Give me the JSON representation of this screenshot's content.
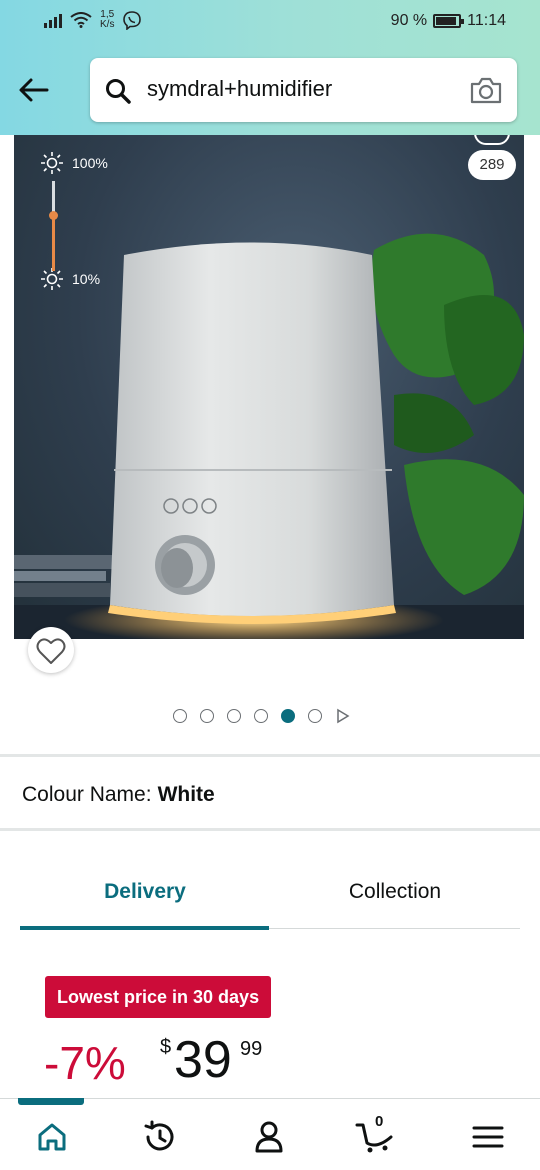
{
  "status_bar": {
    "net_speed_value": "1,5",
    "net_speed_unit": "K/s",
    "battery_percent": "90 %",
    "battery_level": 0.9,
    "time": "11:14"
  },
  "search": {
    "query": "symdral+humidifier"
  },
  "product": {
    "image_count_badge": "289",
    "brightness_max": "100%",
    "brightness_min": "10%",
    "carousel": {
      "total": 6,
      "active_index": 4
    }
  },
  "variation": {
    "label": "Colour Name:",
    "value": "White"
  },
  "tabs": {
    "delivery": "Delivery",
    "collection": "Collection"
  },
  "deal": {
    "badge": "Lowest price in 30 days",
    "discount": "-7%",
    "currency": "$",
    "whole": "39",
    "fraction": "99"
  },
  "bottom_nav": {
    "cart_count": "0",
    "items": [
      "home-icon",
      "history-icon",
      "account-icon",
      "cart-icon",
      "menu-icon"
    ]
  },
  "colors": {
    "accent": "#0b6d7e",
    "deal_red": "#cc0c39"
  }
}
